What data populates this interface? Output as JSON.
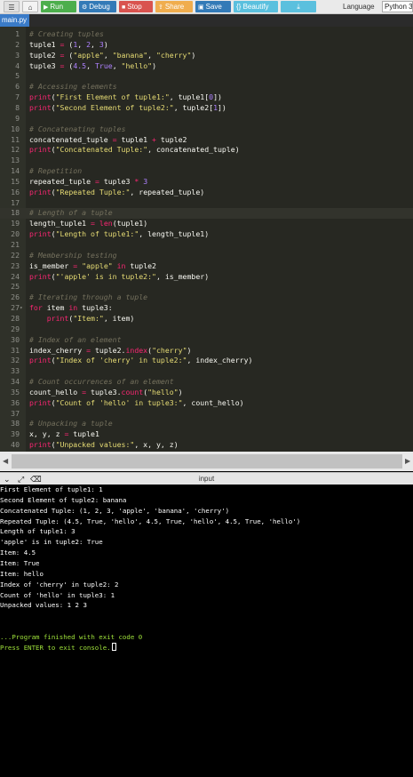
{
  "toolbar": {
    "run_label": "Run",
    "debug_label": "Debug",
    "stop_label": "Stop",
    "share_label": "Share",
    "save_label": "Save",
    "beautify_label": "{} Beautify",
    "download_label": "⤓",
    "language_label": "Language",
    "language_value": "Python 3",
    "icons": {
      "menu": "menu-icon",
      "home": "home-icon",
      "run": "play-icon",
      "debug": "bug-icon",
      "stop": "stop-icon",
      "share": "share-icon",
      "save": "floppy-icon",
      "download": "download-icon"
    }
  },
  "file_tab": {
    "label": "main.py"
  },
  "editor": {
    "theme": {
      "background": "#272822",
      "comment": "#75715e",
      "string": "#e6db74",
      "number": "#ae81ff",
      "keyword": "#f92672"
    },
    "lines": [
      {
        "n": "1",
        "code": [
          [
            "com",
            "# Creating tuples"
          ]
        ]
      },
      {
        "n": "2",
        "code": [
          [
            "txt",
            "tuple1 "
          ],
          [
            "kw",
            "="
          ],
          [
            "txt",
            " ("
          ],
          [
            "num",
            "1"
          ],
          [
            "txt",
            ", "
          ],
          [
            "num",
            "2"
          ],
          [
            "txt",
            ", "
          ],
          [
            "num",
            "3"
          ],
          [
            "txt",
            ")"
          ]
        ]
      },
      {
        "n": "3",
        "code": [
          [
            "txt",
            "tuple2 "
          ],
          [
            "kw",
            "="
          ],
          [
            "txt",
            " ("
          ],
          [
            "str",
            "\"apple\""
          ],
          [
            "txt",
            ", "
          ],
          [
            "str",
            "\"banana\""
          ],
          [
            "txt",
            ", "
          ],
          [
            "str",
            "\"cherry\""
          ],
          [
            "txt",
            ")"
          ]
        ]
      },
      {
        "n": "4",
        "code": [
          [
            "txt",
            "tuple3 "
          ],
          [
            "kw",
            "="
          ],
          [
            "txt",
            " ("
          ],
          [
            "num",
            "4.5"
          ],
          [
            "txt",
            ", "
          ],
          [
            "num",
            "True"
          ],
          [
            "txt",
            ", "
          ],
          [
            "str",
            "\"hello\""
          ],
          [
            "txt",
            ")"
          ]
        ]
      },
      {
        "n": "5",
        "code": []
      },
      {
        "n": "6",
        "code": [
          [
            "com",
            "# Accessing elements"
          ]
        ]
      },
      {
        "n": "7",
        "code": [
          [
            "kw",
            "print"
          ],
          [
            "txt",
            "("
          ],
          [
            "str",
            "\"First Element of tuple1:\""
          ],
          [
            "txt",
            ", tuple1["
          ],
          [
            "num",
            "0"
          ],
          [
            "txt",
            "])"
          ]
        ]
      },
      {
        "n": "8",
        "code": [
          [
            "kw",
            "print"
          ],
          [
            "txt",
            "("
          ],
          [
            "str",
            "\"Second Element of tuple2:\""
          ],
          [
            "txt",
            ", tuple2["
          ],
          [
            "num",
            "1"
          ],
          [
            "txt",
            "])"
          ]
        ]
      },
      {
        "n": "9",
        "code": []
      },
      {
        "n": "10",
        "code": [
          [
            "com",
            "# Concatenating tuples"
          ]
        ]
      },
      {
        "n": "11",
        "code": [
          [
            "txt",
            "concatenated_tuple "
          ],
          [
            "kw",
            "="
          ],
          [
            "txt",
            " tuple1 "
          ],
          [
            "kw",
            "+"
          ],
          [
            "txt",
            " tuple2"
          ]
        ]
      },
      {
        "n": "12",
        "code": [
          [
            "kw",
            "print"
          ],
          [
            "txt",
            "("
          ],
          [
            "str",
            "\"Concatenated Tuple:\""
          ],
          [
            "txt",
            ", concatenated_tuple)"
          ]
        ]
      },
      {
        "n": "13",
        "code": []
      },
      {
        "n": "14",
        "code": [
          [
            "com",
            "# Repetition"
          ]
        ]
      },
      {
        "n": "15",
        "code": [
          [
            "txt",
            "repeated_tuple "
          ],
          [
            "kw",
            "="
          ],
          [
            "txt",
            " tuple3 "
          ],
          [
            "kw",
            "*"
          ],
          [
            "txt",
            " "
          ],
          [
            "num",
            "3"
          ]
        ]
      },
      {
        "n": "16",
        "code": [
          [
            "kw",
            "print"
          ],
          [
            "txt",
            "("
          ],
          [
            "str",
            "\"Repeated Tuple:\""
          ],
          [
            "txt",
            ", repeated_tuple)"
          ]
        ]
      },
      {
        "n": "17",
        "code": []
      },
      {
        "n": "18",
        "code": [
          [
            "com",
            "# Length of a tuple"
          ]
        ]
      },
      {
        "n": "19",
        "code": [
          [
            "txt",
            "length_tuple1 "
          ],
          [
            "kw",
            "="
          ],
          [
            "txt",
            " "
          ],
          [
            "kw",
            "len"
          ],
          [
            "txt",
            "(tuple1)"
          ]
        ]
      },
      {
        "n": "20",
        "code": [
          [
            "kw",
            "print"
          ],
          [
            "txt",
            "("
          ],
          [
            "str",
            "\"Length of tuple1:\""
          ],
          [
            "txt",
            ", length_tuple1)"
          ]
        ]
      },
      {
        "n": "21",
        "code": []
      },
      {
        "n": "22",
        "code": [
          [
            "com",
            "# Membership testing"
          ]
        ]
      },
      {
        "n": "23",
        "code": [
          [
            "txt",
            "is_member "
          ],
          [
            "kw",
            "="
          ],
          [
            "txt",
            " "
          ],
          [
            "str",
            "\"apple\""
          ],
          [
            "txt",
            " "
          ],
          [
            "kw",
            "in"
          ],
          [
            "txt",
            " tuple2"
          ]
        ]
      },
      {
        "n": "24",
        "code": [
          [
            "kw",
            "print"
          ],
          [
            "txt",
            "("
          ],
          [
            "str",
            "\"'apple' is in tuple2:\""
          ],
          [
            "txt",
            ", is_member)"
          ]
        ]
      },
      {
        "n": "25",
        "code": []
      },
      {
        "n": "26",
        "code": [
          [
            "com",
            "# Iterating through a tuple"
          ]
        ]
      },
      {
        "n": "27",
        "fold": true,
        "code": [
          [
            "kw",
            "for"
          ],
          [
            "txt",
            " item "
          ],
          [
            "kw",
            "in"
          ],
          [
            "txt",
            " tuple3:"
          ]
        ]
      },
      {
        "n": "28",
        "code": [
          [
            "txt",
            "    "
          ],
          [
            "kw",
            "print"
          ],
          [
            "txt",
            "("
          ],
          [
            "str",
            "\"Item:\""
          ],
          [
            "txt",
            ", item)"
          ]
        ]
      },
      {
        "n": "29",
        "code": []
      },
      {
        "n": "30",
        "code": [
          [
            "com",
            "# Index of an element"
          ]
        ]
      },
      {
        "n": "31",
        "code": [
          [
            "txt",
            "index_cherry "
          ],
          [
            "kw",
            "="
          ],
          [
            "txt",
            " tuple2."
          ],
          [
            "kw",
            "index"
          ],
          [
            "txt",
            "("
          ],
          [
            "str",
            "\"cherry\""
          ],
          [
            "txt",
            ")"
          ]
        ]
      },
      {
        "n": "32",
        "code": [
          [
            "kw",
            "print"
          ],
          [
            "txt",
            "("
          ],
          [
            "str",
            "\"Index of 'cherry' in tuple2:\""
          ],
          [
            "txt",
            ", index_cherry)"
          ]
        ]
      },
      {
        "n": "33",
        "code": []
      },
      {
        "n": "34",
        "code": [
          [
            "com",
            "# Count occurrences of an element"
          ]
        ]
      },
      {
        "n": "35",
        "code": [
          [
            "txt",
            "count_hello "
          ],
          [
            "kw",
            "="
          ],
          [
            "txt",
            " tuple3."
          ],
          [
            "kw",
            "count"
          ],
          [
            "txt",
            "("
          ],
          [
            "str",
            "\"hello\""
          ],
          [
            "txt",
            ")"
          ]
        ]
      },
      {
        "n": "36",
        "code": [
          [
            "kw",
            "print"
          ],
          [
            "txt",
            "("
          ],
          [
            "str",
            "\"Count of 'hello' in tuple3:\""
          ],
          [
            "txt",
            ", count_hello)"
          ]
        ]
      },
      {
        "n": "37",
        "code": []
      },
      {
        "n": "38",
        "code": [
          [
            "com",
            "# Unpacking a tuple"
          ]
        ]
      },
      {
        "n": "39",
        "code": [
          [
            "txt",
            "x, y, z "
          ],
          [
            "kw",
            "="
          ],
          [
            "txt",
            " tuple1"
          ]
        ]
      },
      {
        "n": "40",
        "code": [
          [
            "kw",
            "print"
          ],
          [
            "txt",
            "("
          ],
          [
            "str",
            "\"Unpacked values:\""
          ],
          [
            "txt",
            ", x, y, z)"
          ]
        ]
      }
    ]
  },
  "console": {
    "header_label": "input",
    "icons": {
      "collapse": "chevron-down-icon",
      "expand": "expand-icon",
      "clear": "clear-icon"
    },
    "output": [
      "First Element of tuple1: 1",
      "Second Element of tuple2: banana",
      "Concatenated Tuple: (1, 2, 3, 'apple', 'banana', 'cherry')",
      "Repeated Tuple: (4.5, True, 'hello', 4.5, True, 'hello', 4.5, True, 'hello')",
      "Length of tuple1: 3",
      "'apple' is in tuple2: True",
      "Item: 4.5",
      "Item: True",
      "Item: hello",
      "Index of 'cherry' in tuple2: 2",
      "Count of 'hello' in tuple3: 1",
      "Unpacked values: 1 2 3",
      "",
      "",
      "...Program finished with exit code 0",
      "Press ENTER to exit console."
    ]
  }
}
